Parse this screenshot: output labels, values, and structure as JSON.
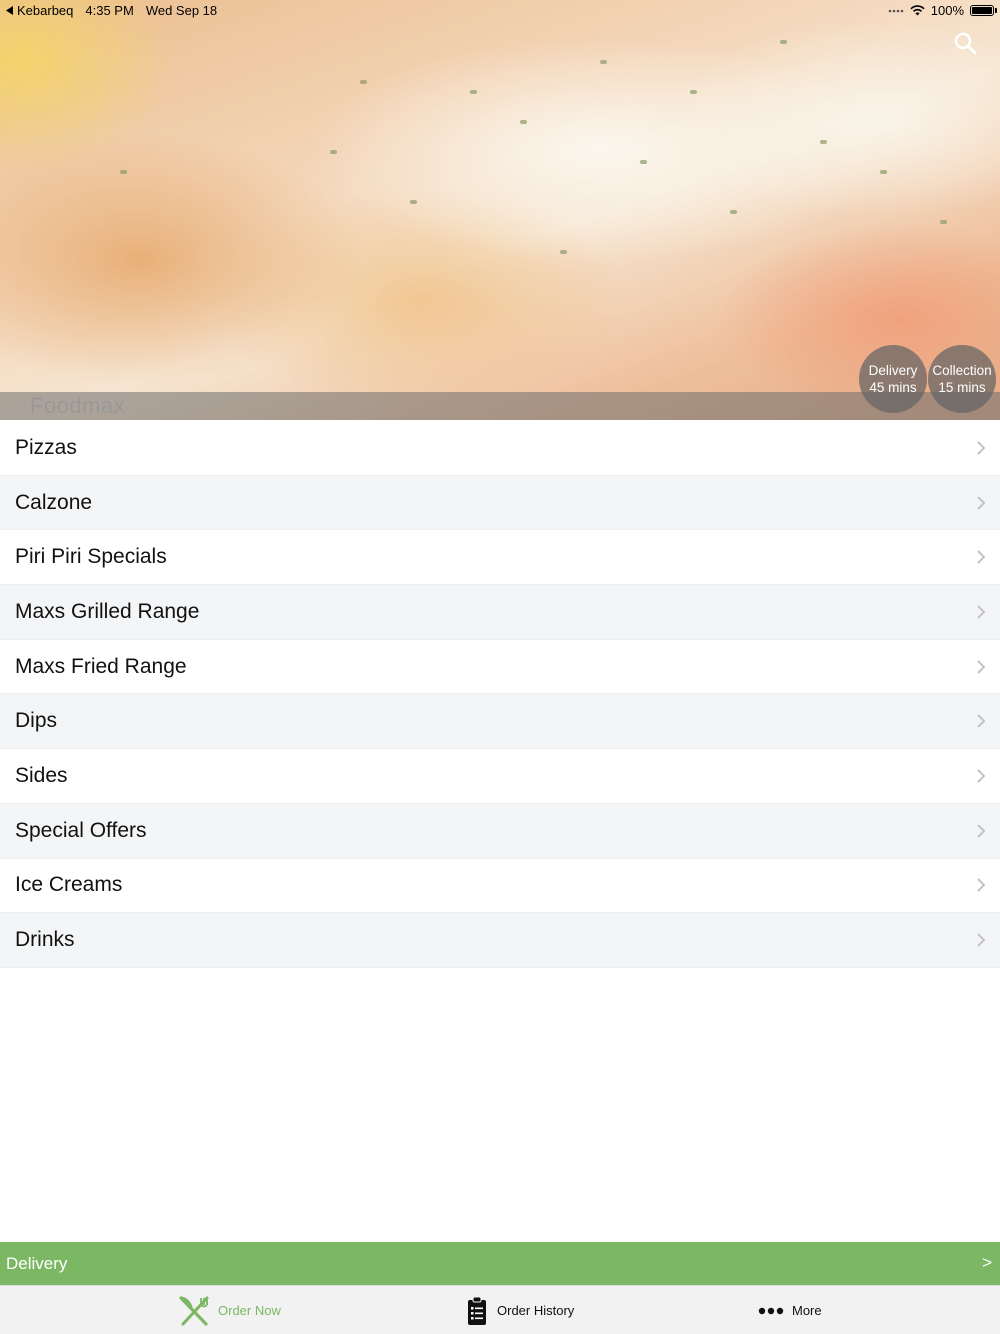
{
  "status_bar": {
    "back_app": "Kebarbeq",
    "time": "4:35 PM",
    "date": "Wed Sep 18",
    "battery": "100%",
    "battery_level": 1.0
  },
  "header": {
    "store_name": "Foodmax",
    "search_icon": "search-icon",
    "delivery_badge": {
      "label": "Delivery",
      "time": "45 mins"
    },
    "collection_badge": {
      "label": "Collection",
      "time": "15 mins"
    }
  },
  "menu": {
    "chevron_icon": "chevron-right-icon",
    "categories": [
      {
        "label": "Pizzas"
      },
      {
        "label": "Calzone"
      },
      {
        "label": "Piri Piri Specials"
      },
      {
        "label": "Maxs Grilled Range"
      },
      {
        "label": "Maxs Fried Range"
      },
      {
        "label": "Dips"
      },
      {
        "label": "Sides"
      },
      {
        "label": "Special Offers"
      },
      {
        "label": "Ice Creams"
      },
      {
        "label": "Drinks"
      }
    ]
  },
  "delivery_bar": {
    "label": "Delivery",
    "arrow": ">"
  },
  "tab_bar": {
    "active_color": "#7cb863",
    "tabs": [
      {
        "label": "Order Now",
        "icon": "fork-knife-icon",
        "active": true
      },
      {
        "label": "Order History",
        "icon": "clipboard-list-icon",
        "active": false
      },
      {
        "label": "More",
        "icon": "more-dots-icon",
        "active": false
      }
    ]
  },
  "colors": {
    "accent": "#7cb863",
    "row_alt": "#f4f5f7",
    "badge_bg": "#646464"
  }
}
